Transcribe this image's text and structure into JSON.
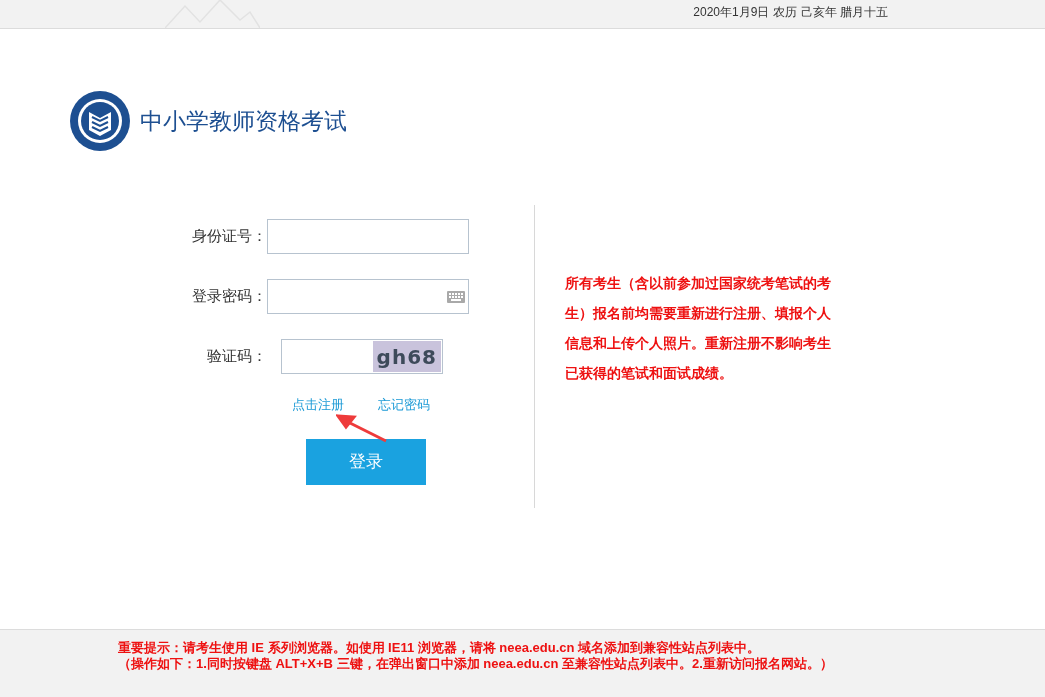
{
  "header": {
    "date": "2020年1月9日",
    "lunar": "农历 己亥年 腊月十五"
  },
  "logo": {
    "title": "中小学教师资格考试"
  },
  "form": {
    "fields": [
      {
        "kind": "text",
        "label": "身份证号："
      },
      {
        "kind": "password",
        "label": "登录密码："
      },
      {
        "kind": "captcha",
        "label": "验证码：",
        "captcha": "gh68"
      }
    ],
    "links": [
      "点击注册",
      "忘记密码"
    ],
    "submit": "登录"
  },
  "notice": "所有考生（含以前参加过国家统考笔试的考生）报名前均需要重新进行注册、填报个人信息和上传个人照片。重新注册不影响考生已获得的笔试和面试成绩。",
  "footer": [
    "重要提示：请考生使用 IE 系列浏览器。如使用 IE11 浏览器，请将 neea.edu.cn 域名添加到兼容性站点列表中。",
    "（操作如下：1.同时按键盘 ALT+X+B 三键，在弹出窗口中添加 neea.edu.cn 至兼容性站点列表中。2.重新访问报名网站。）"
  ]
}
